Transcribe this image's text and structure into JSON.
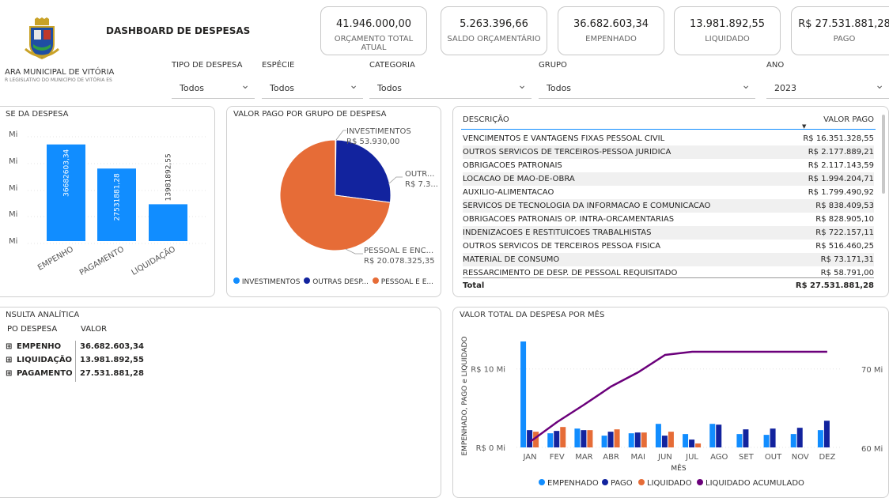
{
  "header": {
    "org_name": "ARA MUNICIPAL DE VITÓRIA",
    "org_sub": "R LEGISLATIVO DO MUNICÍPIO DE VITÓRIA ES",
    "title": "DASHBOARD DE DESPESAS"
  },
  "kpis": [
    {
      "value": "41.946.000,00",
      "label": "ORÇAMENTO TOTAL ATUAL"
    },
    {
      "value": "5.263.396,66",
      "label": "SALDO ORÇAMENTÁRIO"
    },
    {
      "value": "36.682.603,34",
      "label": "EMPENHADO"
    },
    {
      "value": "13.981.892,55",
      "label": "LIQUIDADO"
    },
    {
      "value": "R$ 27.531.881,28",
      "label": "PAGO"
    }
  ],
  "filters": [
    {
      "label": "TIPO DE DESPESA",
      "value": "Todos"
    },
    {
      "label": "ESPÉCIE",
      "value": "Todos"
    },
    {
      "label": "CATEGORIA",
      "value": "Todos"
    },
    {
      "label": "GRUPO",
      "value": "Todos"
    },
    {
      "label": "ANO",
      "value": "2023"
    }
  ],
  "phase_panel": {
    "title": "SE DA DESPESA",
    "axis_label": "Mi"
  },
  "pie_panel": {
    "title": "VALOR PAGO POR GRUPO DE DESPESA",
    "legend": [
      "INVESTIMENTOS",
      "OUTRAS DESP...",
      "PESSOAL E E..."
    ],
    "labels": [
      {
        "name": "INVESTIMENTOS",
        "value": "R$ 53.930,00"
      },
      {
        "name": "OUTR...",
        "value": "R$ 7.3..."
      },
      {
        "name": "PESSOAL E ENC...",
        "value": "R$ 20.078.325,35"
      }
    ]
  },
  "table": {
    "col_desc": "DESCRIÇÃO",
    "col_value": "VALOR PAGO",
    "rows": [
      {
        "desc": "VENCIMENTOS E VANTAGENS FIXAS PESSOAL CIVIL",
        "value": "R$ 16.351.328,55"
      },
      {
        "desc": "OUTROS SERVICOS DE TERCEIROS-PESSOA JURIDICA",
        "value": "R$ 2.177.889,21"
      },
      {
        "desc": "OBRIGACOES PATRONAIS",
        "value": "R$ 2.117.143,59"
      },
      {
        "desc": "LOCACAO DE MAO-DE-OBRA",
        "value": "R$ 1.994.204,71"
      },
      {
        "desc": "AUXILIO-ALIMENTACAO",
        "value": "R$ 1.799.490,92"
      },
      {
        "desc": "SERVICOS DE TECNOLOGIA DA INFORMACAO E COMUNICACAO",
        "value": "R$ 838.409,53"
      },
      {
        "desc": "OBRIGACOES PATRONAIS OP. INTRA-ORCAMENTARIAS",
        "value": "R$ 828.905,10"
      },
      {
        "desc": "INDENIZACOES E RESTITUICOES TRABALHISTAS",
        "value": "R$ 722.157,11"
      },
      {
        "desc": "OUTROS SERVICOS DE TERCEIROS PESSOA FISICA",
        "value": "R$ 516.460,25"
      },
      {
        "desc": "MATERIAL DE CONSUMO",
        "value": "R$ 73.171,31"
      },
      {
        "desc": "RESSARCIMENTO DE DESP. DE PESSOAL REQUISITADO",
        "value": "R$ 58.791,00"
      }
    ],
    "total_label": "Total",
    "total_value": "R$ 27.531.881,28"
  },
  "consulta": {
    "title": "NSULTA ANALÍTICA",
    "col1": "PO DESPESA",
    "col2": "VALOR",
    "rows": [
      {
        "name": "EMPENHO",
        "value": "36.682.603,34"
      },
      {
        "name": "LIQUIDAÇÃO",
        "value": "13.981.892,55"
      },
      {
        "name": "PAGAMENTO",
        "value": "27.531.881,28"
      }
    ]
  },
  "month_panel": {
    "title": "VALOR TOTAL DA DESPESA POR MÊS"
  },
  "colors": {
    "empenhado": "#118DFF",
    "pago": "#12239E",
    "liquidado": "#E66C37",
    "acumulado": "#6B007B"
  },
  "chart_data": [
    {
      "type": "bar",
      "categories": [
        "EMPENHO",
        "PAGAMENTO",
        "LIQUIDAÇÃO"
      ],
      "values": [
        36682603.34,
        27531881.28,
        13981892.55
      ],
      "data_labels": [
        "36682603,34",
        "27531881,28",
        "13981892,55"
      ]
    },
    {
      "type": "pie",
      "categories": [
        "INVESTIMENTOS",
        "OUTRAS DESPESAS",
        "PESSOAL E ENCARGOS"
      ],
      "values": [
        53930.0,
        7399625.93,
        20078325.35
      ]
    },
    {
      "type": "bar",
      "xlabel": "MÊS",
      "ylabel": "EMPENHADO, PAGO e LIQUIDADO",
      "categories": [
        "JAN",
        "FEV",
        "MAR",
        "ABR",
        "MAI",
        "JUN",
        "JUL",
        "AGO",
        "SET",
        "OUT",
        "NOV",
        "DEZ"
      ],
      "ylim": [
        0,
        14000000
      ],
      "y_ticks": [
        {
          "value": 0,
          "label": "R$ 0 Mi"
        },
        {
          "value": 10000000,
          "label": "R$ 10 Mi"
        }
      ],
      "y2_ticks": [
        {
          "value": 60000000,
          "label": "60 Mi"
        },
        {
          "value": 70000000,
          "label": "70 Mi"
        }
      ],
      "series": [
        {
          "name": "EMPENHADO",
          "values": [
            13500000,
            1800000,
            2400000,
            1500000,
            1800000,
            3000000,
            1700000,
            3000000,
            1700000,
            1600000,
            1700000,
            2200000
          ]
        },
        {
          "name": "PAGO",
          "values": [
            2200000,
            2100000,
            2200000,
            2000000,
            1900000,
            1500000,
            1000000,
            2900000,
            2300000,
            2400000,
            2500000,
            3400000
          ]
        },
        {
          "name": "LIQUIDADO",
          "values": [
            2000000,
            2600000,
            2200000,
            2300000,
            1900000,
            2000000,
            500000,
            0,
            0,
            0,
            0,
            0
          ]
        },
        {
          "name": "LIQUIDADO ACUMULADO",
          "axis": "y2",
          "values": [
            60800000,
            63300000,
            65500000,
            67800000,
            69600000,
            71800000,
            72200000,
            72200000,
            72200000,
            72200000,
            72200000,
            72200000
          ]
        }
      ]
    }
  ]
}
